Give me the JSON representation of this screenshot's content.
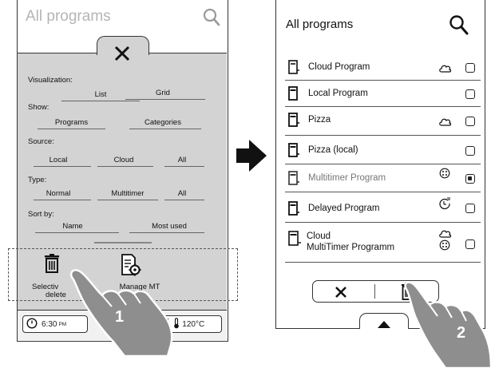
{
  "left_panel": {
    "title": "All programs",
    "sections": {
      "visualization": {
        "label": "Visualization:",
        "options": [
          "List",
          "Grid"
        ]
      },
      "show": {
        "label": "Show:",
        "options": [
          "Programs",
          "Categories"
        ]
      },
      "source": {
        "label": "Source:",
        "options": [
          "Local",
          "Cloud",
          "All"
        ]
      },
      "type": {
        "label": "Type:",
        "options": [
          "Normal",
          "Multitimer",
          "All"
        ]
      },
      "sort_by": {
        "label": "Sort by:",
        "options": [
          "Name",
          "Most used"
        ]
      }
    },
    "actions": {
      "selective_delete_label_line1": "Selectiv",
      "selective_delete_label_line2": "delete",
      "manage_mt_label": "Manage MT"
    },
    "status": {
      "time": "6:30",
      "time_suffix": "PM",
      "temperature": "120°C"
    }
  },
  "right_panel": {
    "title": "All programs",
    "programs": [
      {
        "name": "Cloud Program",
        "cloud": true,
        "multitimer": false,
        "delayed": false,
        "selected": false,
        "dim": false
      },
      {
        "name": "Local Program",
        "cloud": false,
        "multitimer": false,
        "delayed": false,
        "selected": false,
        "dim": false
      },
      {
        "name": "Pizza",
        "cloud": true,
        "multitimer": false,
        "delayed": false,
        "selected": false,
        "dim": false
      },
      {
        "name": "Pizza (local)",
        "cloud": false,
        "multitimer": false,
        "delayed": false,
        "selected": false,
        "dim": false
      },
      {
        "name": "Multitimer Program",
        "cloud": false,
        "multitimer": true,
        "delayed": false,
        "selected": true,
        "dim": true
      },
      {
        "name": "Delayed Program",
        "cloud": false,
        "multitimer": false,
        "delayed": true,
        "selected": false,
        "dim": false
      },
      {
        "name_line1": "Cloud",
        "name_line2": "MultiTimer Programm",
        "cloud": true,
        "multitimer": true,
        "delayed": false,
        "selected": false,
        "dim": false
      }
    ]
  },
  "callouts": {
    "step1": "1",
    "step2": "2"
  },
  "colors": {
    "panel_grey": "#d3d3d3",
    "hand_grey": "#8e8e8e",
    "ink": "#222222"
  }
}
